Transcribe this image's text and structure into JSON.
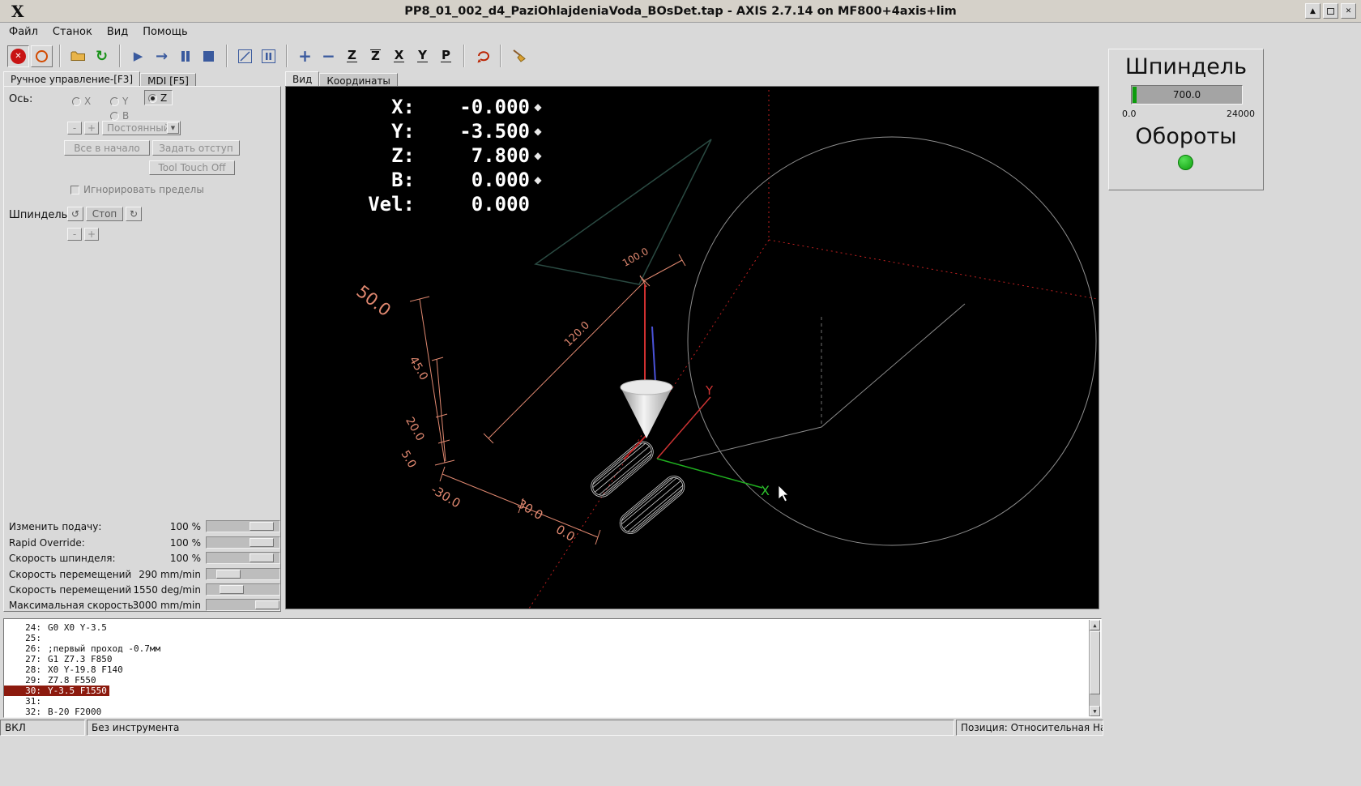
{
  "titlebar": {
    "logo": "X",
    "title": "PP8_01_002_d4_PaziOhlajdeniaVoda_BOsDet.tap - AXIS 2.7.14 on MF800+4axis+lim"
  },
  "icons": {
    "minimize": "▲",
    "close": "✕",
    "estop_x": "✕",
    "reload": "↻",
    "run": "▶",
    "step": "→",
    "ccw": "↺",
    "cw": "↻",
    "dropdown_arrow": "▼",
    "scroll_up": "▲",
    "scroll_down": "▼",
    "homed": "◆"
  },
  "menu": {
    "file": "Файл",
    "machine": "Станок",
    "view": "Вид",
    "help": "Помощь"
  },
  "toolbar": {
    "zoom_in": "+",
    "zoom_out": "−",
    "letters": {
      "ztop": "Z",
      "zback": "Z",
      "x": "X",
      "y": "Y",
      "p": "P"
    }
  },
  "manual": {
    "tab_manual": "Ручное управление-[F3]",
    "tab_mdi": "MDI [F5]",
    "axis_label": "Ось:",
    "axis_x": "X",
    "axis_y": "Y",
    "axis_z": "Z",
    "axis_b": "B",
    "jog_minus": "-",
    "jog_plus": "+",
    "jog_mode": "Постоянный",
    "home_all": "Все в начало",
    "touch_off": "Задать отступ",
    "tool_touch_off": "Tool Touch Off",
    "ignore_limits": "Игнорировать пределы",
    "spindle_label": "Шпиндель:",
    "spindle_stop": "Стоп",
    "spindle_minus": "-",
    "spindle_plus": "+",
    "sliders": [
      {
        "label": "Изменить подачу:",
        "value": "100 %"
      },
      {
        "label": "Rapid Override:",
        "value": "100 %"
      },
      {
        "label": "Скорость шпинделя:",
        "value": "100 %"
      },
      {
        "label": "Скорость перемещений",
        "value": "290 mm/min"
      },
      {
        "label": "Скорость перемещений",
        "value": "1550 deg/min"
      },
      {
        "label": "Максимальная скорость:",
        "value": "3000 mm/min"
      }
    ]
  },
  "view": {
    "tab_view": "Вид",
    "tab_coords": "Координаты",
    "dro": [
      {
        "label": "X:",
        "value": "-0.000"
      },
      {
        "label": "Y:",
        "value": "-3.500"
      },
      {
        "label": "Z:",
        "value": "7.800"
      },
      {
        "label": "B:",
        "value": "0.000"
      },
      {
        "label": "Vel:",
        "value": "0.000"
      }
    ],
    "dims": [
      "50.0",
      "100.0",
      "120.0",
      "45.0",
      "20.0",
      "5.0",
      "-30.0",
      "30.0",
      "0.0"
    ],
    "axis_x": "X",
    "axis_y": "Y"
  },
  "spindle": {
    "title": "Шпиндель",
    "value": "700.0",
    "min": "0.0",
    "max": "24000",
    "rpm": "Обороты"
  },
  "gcode": {
    "lines": [
      {
        "n": "24:",
        "t": "G0 X0 Y-3.5"
      },
      {
        "n": "25:",
        "t": ""
      },
      {
        "n": "26:",
        "t": ";первый проход -0.7мм"
      },
      {
        "n": "27:",
        "t": "G1 Z7.3 F850"
      },
      {
        "n": "28:",
        "t": "X0 Y-19.8 F140"
      },
      {
        "n": "29:",
        "t": "Z7.8 F550"
      },
      {
        "n": "30:",
        "t": "Y-3.5 F1550"
      },
      {
        "n": "31:",
        "t": ""
      },
      {
        "n": "32:",
        "t": "B-20 F2000"
      }
    ]
  },
  "status": {
    "power": "ВКЛ",
    "tool": "Без инструмента",
    "position": "Позиция: Относительная Насто:"
  }
}
